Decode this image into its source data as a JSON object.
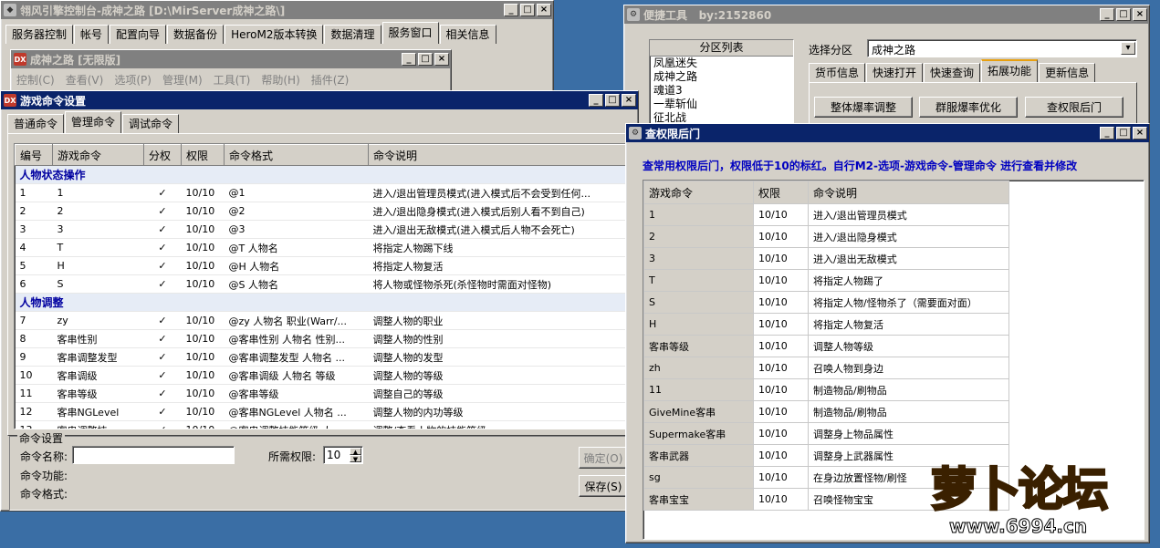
{
  "main_window": {
    "title": "翎风引擎控制台-成神之路 [D:\\MirServer成神之路\\]",
    "tabs": [
      "服务器控制",
      "帐号",
      "配置向导",
      "数据备份",
      "HeroM2版本转换",
      "数据清理",
      "服务窗口",
      "相关信息"
    ],
    "selected_tab": "服务窗口"
  },
  "server_window": {
    "title": "成神之路 [无限版]",
    "menu": [
      "控制(C)",
      "查看(V)",
      "选项(P)",
      "管理(M)",
      "工具(T)",
      "帮助(H)",
      "插件(Z)"
    ]
  },
  "cmd_window": {
    "title": "游戏命令设置",
    "tabs": [
      "普通命令",
      "管理命令",
      "调试命令"
    ],
    "selected_tab": "管理命令",
    "columns": [
      "编号",
      "游戏命令",
      "分权",
      "权限",
      "命令格式",
      "命令说明"
    ],
    "groups": [
      {
        "name": "人物状态操作",
        "rows": [
          [
            "1",
            "1",
            "✓",
            "10/10",
            "@1",
            "进入/退出管理员模式(进入模式后不会受到任何..."
          ],
          [
            "2",
            "2",
            "✓",
            "10/10",
            "@2",
            "进入/退出隐身模式(进入模式后别人看不到自己)"
          ],
          [
            "3",
            "3",
            "✓",
            "10/10",
            "@3",
            "进入/退出无敌模式(进入模式后人物不会死亡)"
          ],
          [
            "4",
            "T",
            "✓",
            "10/10",
            "@T 人物名",
            "将指定人物踢下线"
          ],
          [
            "5",
            "H",
            "✓",
            "10/10",
            "@H 人物名",
            "将指定人物复活"
          ],
          [
            "6",
            "S",
            "✓",
            "10/10",
            "@S 人物名",
            "将人物或怪物杀死(杀怪物时需面对怪物)"
          ]
        ]
      },
      {
        "name": "人物调整",
        "rows": [
          [
            "7",
            "zy",
            "✓",
            "10/10",
            "@zy 人物名 职业(Warr/...",
            "调整人物的职业"
          ],
          [
            "8",
            "客串性别",
            "✓",
            "10/10",
            "@客串性别 人物名 性别...",
            "调整人物的性别"
          ],
          [
            "9",
            "客串调整发型",
            "✓",
            "10/10",
            "@客串调整发型 人物名 ...",
            "调整人物的发型"
          ],
          [
            "10",
            "客串调级",
            "✓",
            "10/10",
            "@客串调级 人物名 等级",
            "调整人物的等级"
          ],
          [
            "11",
            "客串等级",
            "✓",
            "10/10",
            "@客串等级",
            "调整自己的等级"
          ],
          [
            "12",
            "客串NGLevel",
            "✓",
            "10/10",
            "@客串NGLevel 人物名 ...",
            "调整人物的内功等级"
          ],
          [
            "13",
            "客串调整技",
            "✓",
            "10/10",
            "@客串调整技能等级 人...",
            "调整/查看人物的技能等级"
          ]
        ]
      }
    ],
    "settings": {
      "group_label": "命令设置",
      "name_label": "命令名称:",
      "name_value": "",
      "func_label": "命令功能:",
      "format_label": "命令格式:",
      "perm_label": "所需权限:",
      "perm_value": "10",
      "ok_button": "确定(O)",
      "save_button": "保存(S)"
    }
  },
  "quick_window": {
    "title": "便捷工具",
    "by": "by:2152860",
    "list_header": "分区列表",
    "list_items": [
      "凤凰迷失",
      "成神之路",
      "魂道3",
      "一辈斩仙",
      "征北战"
    ],
    "select_label": "选择分区",
    "select_value": "成神之路",
    "tabs": [
      "货币信息",
      "快速打开",
      "快速查询",
      "拓展功能",
      "更新信息"
    ],
    "selected_tab": "拓展功能",
    "buttons": [
      "整体爆率调整",
      "群服爆率优化",
      "查权限后门"
    ]
  },
  "backdoor_window": {
    "title": "查权限后门",
    "notice": "查常用权限后门，权限低于10的标红。自行M2-选项-游戏命令-管理命令 进行查看并修改",
    "columns": [
      "游戏命令",
      "权限",
      "命令说明"
    ],
    "rows": [
      [
        "1",
        "10/10",
        "进入/退出管理员模式"
      ],
      [
        "2",
        "10/10",
        "进入/退出隐身模式"
      ],
      [
        "3",
        "10/10",
        "进入/退出无敌模式"
      ],
      [
        "T",
        "10/10",
        "将指定人物踢了"
      ],
      [
        "S",
        "10/10",
        "将指定人物/怪物杀了（需要面对面）"
      ],
      [
        "H",
        "10/10",
        "将指定人物复活"
      ],
      [
        "客串等级",
        "10/10",
        "调整人物等级"
      ],
      [
        "zh",
        "10/10",
        "召唤人物到身边"
      ],
      [
        "11",
        "10/10",
        "制造物品/刷物品"
      ],
      [
        "GiveMine客串",
        "10/10",
        "制造物品/刷物品"
      ],
      [
        "Supermake客串",
        "10/10",
        "调整身上物品属性"
      ],
      [
        "客串武器",
        "10/10",
        "调整身上武器属性"
      ],
      [
        "sg",
        "10/10",
        "在身边放置怪物/刷怪"
      ],
      [
        "客串宝宝",
        "10/10",
        "召唤怪物宝宝"
      ]
    ]
  },
  "watermark": {
    "logo_text": "萝卜论坛",
    "url": "www.6994.cn"
  },
  "colors": {
    "desktop": "#3a6ea5",
    "title_active": "#0a246a",
    "group_text": "#0000a0",
    "notice_text": "#0000c0"
  }
}
